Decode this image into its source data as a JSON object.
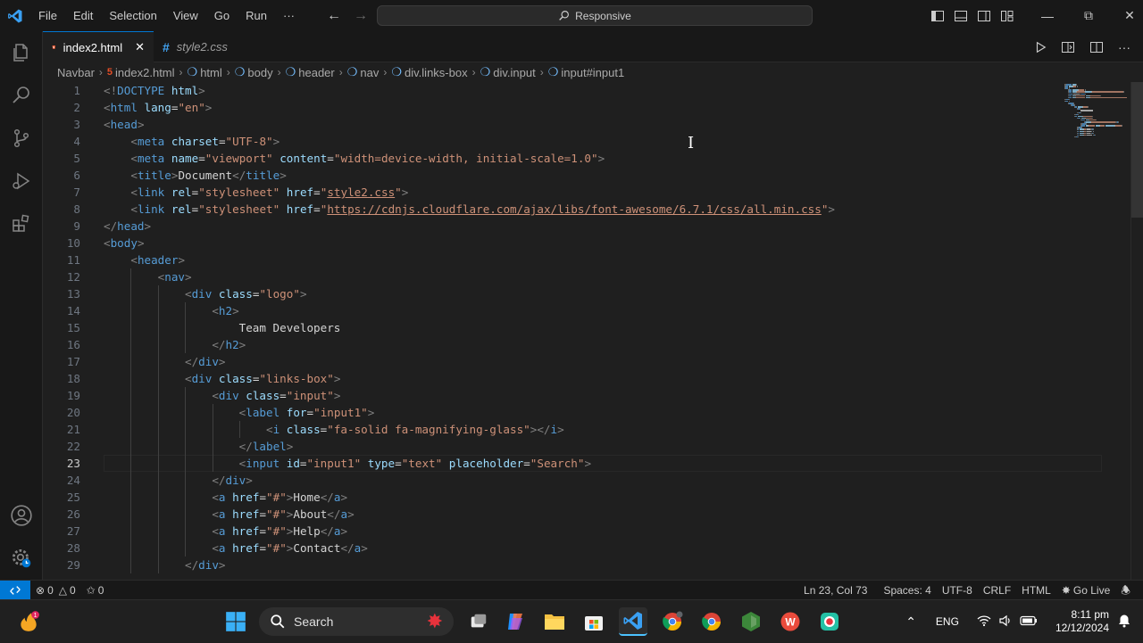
{
  "menu": [
    "File",
    "Edit",
    "Selection",
    "View",
    "Go",
    "Run",
    "···"
  ],
  "command_center": "Responsive",
  "tabs": [
    {
      "label": "index2.html",
      "icon": "html-file-icon",
      "active": true
    },
    {
      "label": "style2.css",
      "icon": "css-file-icon",
      "active": false
    }
  ],
  "breadcrumb": [
    "Navbar",
    "index2.html",
    "html",
    "body",
    "header",
    "nav",
    "div.links-box",
    "div.input",
    "input#input1"
  ],
  "code_lines": [
    [
      [
        "br",
        "<!"
      ],
      [
        "tag",
        "DOCTYPE"
      ],
      [
        "attr",
        " html"
      ],
      [
        "br",
        ">"
      ]
    ],
    [
      [
        "br",
        "<"
      ],
      [
        "tag",
        "html"
      ],
      [
        "attr",
        " lang"
      ],
      [
        "txt",
        "="
      ],
      [
        "str",
        "\"en\""
      ],
      [
        "br",
        ">"
      ]
    ],
    [
      [
        "br",
        "<"
      ],
      [
        "tag",
        "head"
      ],
      [
        "br",
        ">"
      ]
    ],
    [
      [
        "txt",
        "    "
      ],
      [
        "br",
        "<"
      ],
      [
        "tag",
        "meta"
      ],
      [
        "attr",
        " charset"
      ],
      [
        "txt",
        "="
      ],
      [
        "str",
        "\"UTF-8\""
      ],
      [
        "br",
        ">"
      ]
    ],
    [
      [
        "txt",
        "    "
      ],
      [
        "br",
        "<"
      ],
      [
        "tag",
        "meta"
      ],
      [
        "attr",
        " name"
      ],
      [
        "txt",
        "="
      ],
      [
        "str",
        "\"viewport\""
      ],
      [
        "attr",
        " content"
      ],
      [
        "txt",
        "="
      ],
      [
        "str",
        "\"width=device-width, initial-scale=1.0\""
      ],
      [
        "br",
        ">"
      ]
    ],
    [
      [
        "txt",
        "    "
      ],
      [
        "br",
        "<"
      ],
      [
        "tag",
        "title"
      ],
      [
        "br",
        ">"
      ],
      [
        "txt",
        "Document"
      ],
      [
        "br",
        "</"
      ],
      [
        "tag",
        "title"
      ],
      [
        "br",
        ">"
      ]
    ],
    [
      [
        "txt",
        "    "
      ],
      [
        "br",
        "<"
      ],
      [
        "tag",
        "link"
      ],
      [
        "attr",
        " rel"
      ],
      [
        "txt",
        "="
      ],
      [
        "str",
        "\"stylesheet\""
      ],
      [
        "attr",
        " href"
      ],
      [
        "txt",
        "="
      ],
      [
        "str",
        "\""
      ],
      [
        "link",
        "style2.css"
      ],
      [
        "str",
        "\""
      ],
      [
        "br",
        ">"
      ]
    ],
    [
      [
        "txt",
        "    "
      ],
      [
        "br",
        "<"
      ],
      [
        "tag",
        "link"
      ],
      [
        "attr",
        " rel"
      ],
      [
        "txt",
        "="
      ],
      [
        "str",
        "\"stylesheet\""
      ],
      [
        "attr",
        " href"
      ],
      [
        "txt",
        "="
      ],
      [
        "str",
        "\""
      ],
      [
        "link",
        "https://cdnjs.cloudflare.com/ajax/libs/font-awesome/6.7.1/css/all.min.css"
      ],
      [
        "str",
        "\""
      ],
      [
        "br",
        ">"
      ]
    ],
    [
      [
        "br",
        "</"
      ],
      [
        "tag",
        "head"
      ],
      [
        "br",
        ">"
      ]
    ],
    [
      [
        "br",
        "<"
      ],
      [
        "tag",
        "body"
      ],
      [
        "br",
        ">"
      ]
    ],
    [
      [
        "txt",
        "    "
      ],
      [
        "br",
        "<"
      ],
      [
        "tag",
        "header"
      ],
      [
        "br",
        ">"
      ]
    ],
    [
      [
        "txt",
        "        "
      ],
      [
        "br",
        "<"
      ],
      [
        "tag",
        "nav"
      ],
      [
        "br",
        ">"
      ]
    ],
    [
      [
        "txt",
        "            "
      ],
      [
        "br",
        "<"
      ],
      [
        "tag",
        "div"
      ],
      [
        "attr",
        " class"
      ],
      [
        "txt",
        "="
      ],
      [
        "str",
        "\"logo\""
      ],
      [
        "br",
        ">"
      ]
    ],
    [
      [
        "txt",
        "                "
      ],
      [
        "br",
        "<"
      ],
      [
        "tag",
        "h2"
      ],
      [
        "br",
        ">"
      ]
    ],
    [
      [
        "txt",
        "                    Team Developers"
      ]
    ],
    [
      [
        "txt",
        "                "
      ],
      [
        "br",
        "</"
      ],
      [
        "tag",
        "h2"
      ],
      [
        "br",
        ">"
      ]
    ],
    [
      [
        "txt",
        "            "
      ],
      [
        "br",
        "</"
      ],
      [
        "tag",
        "div"
      ],
      [
        "br",
        ">"
      ]
    ],
    [
      [
        "txt",
        "            "
      ],
      [
        "br",
        "<"
      ],
      [
        "tag",
        "div"
      ],
      [
        "attr",
        " class"
      ],
      [
        "txt",
        "="
      ],
      [
        "str",
        "\"links-box\""
      ],
      [
        "br",
        ">"
      ]
    ],
    [
      [
        "txt",
        "                "
      ],
      [
        "br",
        "<"
      ],
      [
        "tag",
        "div"
      ],
      [
        "attr",
        " class"
      ],
      [
        "txt",
        "="
      ],
      [
        "str",
        "\"input\""
      ],
      [
        "br",
        ">"
      ]
    ],
    [
      [
        "txt",
        "                    "
      ],
      [
        "br",
        "<"
      ],
      [
        "tag",
        "label"
      ],
      [
        "attr",
        " for"
      ],
      [
        "txt",
        "="
      ],
      [
        "str",
        "\"input1\""
      ],
      [
        "br",
        ">"
      ]
    ],
    [
      [
        "txt",
        "                        "
      ],
      [
        "br",
        "<"
      ],
      [
        "tag",
        "i"
      ],
      [
        "attr",
        " class"
      ],
      [
        "txt",
        "="
      ],
      [
        "str",
        "\"fa-solid fa-magnifying-glass\""
      ],
      [
        "br",
        "></"
      ],
      [
        "tag",
        "i"
      ],
      [
        "br",
        ">"
      ]
    ],
    [
      [
        "txt",
        "                    "
      ],
      [
        "br",
        "</"
      ],
      [
        "tag",
        "label"
      ],
      [
        "br",
        ">"
      ]
    ],
    [
      [
        "txt",
        "                    "
      ],
      [
        "br",
        "<"
      ],
      [
        "tag",
        "input"
      ],
      [
        "attr",
        " id"
      ],
      [
        "txt",
        "="
      ],
      [
        "str",
        "\"input1\""
      ],
      [
        "attr",
        " type"
      ],
      [
        "txt",
        "="
      ],
      [
        "str",
        "\"text\""
      ],
      [
        "attr",
        " placeholder"
      ],
      [
        "txt",
        "="
      ],
      [
        "str",
        "\"Search\""
      ],
      [
        "br",
        ">"
      ]
    ],
    [
      [
        "txt",
        "                "
      ],
      [
        "br",
        "</"
      ],
      [
        "tag",
        "div"
      ],
      [
        "br",
        ">"
      ]
    ],
    [
      [
        "txt",
        "                "
      ],
      [
        "br",
        "<"
      ],
      [
        "tag",
        "a"
      ],
      [
        "attr",
        " href"
      ],
      [
        "txt",
        "="
      ],
      [
        "str",
        "\"#\""
      ],
      [
        "br",
        ">"
      ],
      [
        "txt",
        "Home"
      ],
      [
        "br",
        "</"
      ],
      [
        "tag",
        "a"
      ],
      [
        "br",
        ">"
      ]
    ],
    [
      [
        "txt",
        "                "
      ],
      [
        "br",
        "<"
      ],
      [
        "tag",
        "a"
      ],
      [
        "attr",
        " href"
      ],
      [
        "txt",
        "="
      ],
      [
        "str",
        "\"#\""
      ],
      [
        "br",
        ">"
      ],
      [
        "txt",
        "About"
      ],
      [
        "br",
        "</"
      ],
      [
        "tag",
        "a"
      ],
      [
        "br",
        ">"
      ]
    ],
    [
      [
        "txt",
        "                "
      ],
      [
        "br",
        "<"
      ],
      [
        "tag",
        "a"
      ],
      [
        "attr",
        " href"
      ],
      [
        "txt",
        "="
      ],
      [
        "str",
        "\"#\""
      ],
      [
        "br",
        ">"
      ],
      [
        "txt",
        "Help"
      ],
      [
        "br",
        "</"
      ],
      [
        "tag",
        "a"
      ],
      [
        "br",
        ">"
      ]
    ],
    [
      [
        "txt",
        "                "
      ],
      [
        "br",
        "<"
      ],
      [
        "tag",
        "a"
      ],
      [
        "attr",
        " href"
      ],
      [
        "txt",
        "="
      ],
      [
        "str",
        "\"#\""
      ],
      [
        "br",
        ">"
      ],
      [
        "txt",
        "Contact"
      ],
      [
        "br",
        "</"
      ],
      [
        "tag",
        "a"
      ],
      [
        "br",
        ">"
      ]
    ],
    [
      [
        "txt",
        "            "
      ],
      [
        "br",
        "</"
      ],
      [
        "tag",
        "div"
      ],
      [
        "br",
        ">"
      ]
    ]
  ],
  "current_line": 23,
  "status": {
    "errors": "0",
    "warnings": "0",
    "ports": "0",
    "position": "Ln 23, Col 73",
    "spaces": "Spaces: 4",
    "encoding": "UTF-8",
    "eol": "CRLF",
    "language": "HTML",
    "go_live": "Go Live"
  },
  "taskbar": {
    "search_label": "Search",
    "language": "ENG",
    "time": "8:11 pm",
    "date": "12/12/2024",
    "notification_badge": "1"
  },
  "colors": {
    "accent": "#0078d4",
    "editor_bg": "#1f1f1f",
    "chrome_bg": "#181818",
    "tag": "#569cd6",
    "attr": "#9cdcfe",
    "string": "#ce9178"
  }
}
